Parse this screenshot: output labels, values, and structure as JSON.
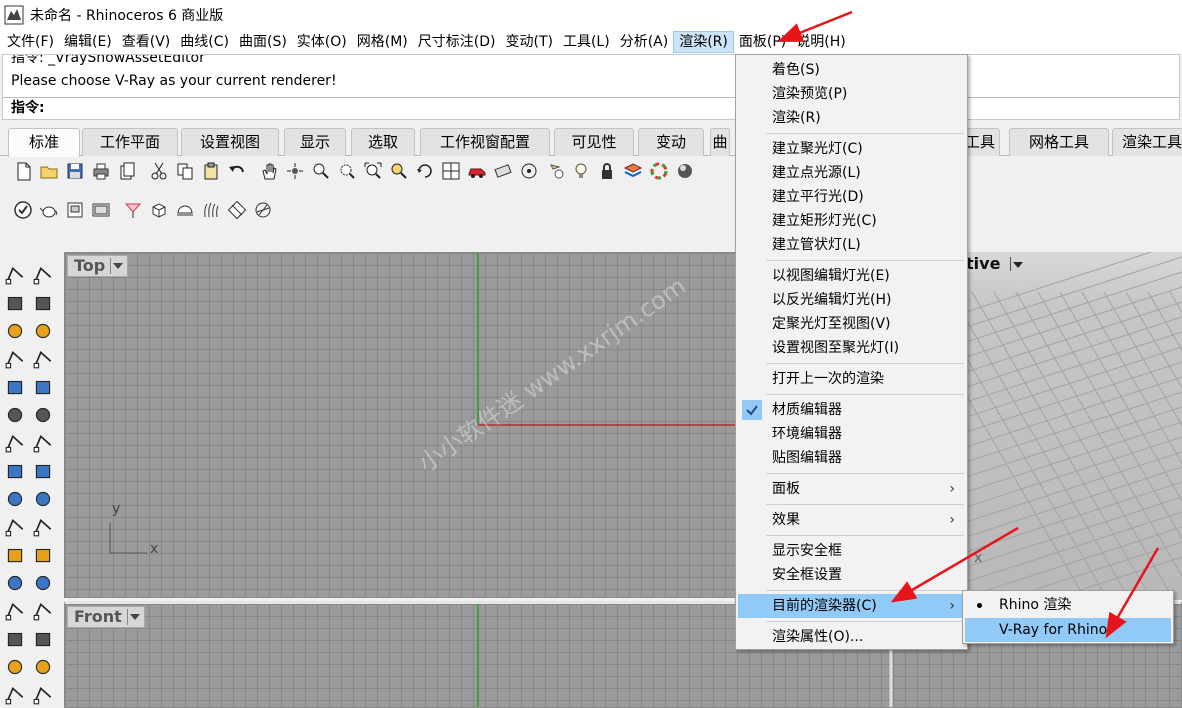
{
  "window": {
    "title": "未命名 - Rhinoceros 6 商业版"
  },
  "menubar": {
    "items": [
      "文件(F)",
      "编辑(E)",
      "查看(V)",
      "曲线(C)",
      "曲面(S)",
      "实体(O)",
      "网格(M)",
      "尺寸标注(D)",
      "变动(T)",
      "工具(L)",
      "分析(A)",
      "渲染(R)",
      "面板(P)",
      "说明(H)"
    ],
    "active_index": 11
  },
  "command": {
    "history_partial": "指令: _VrayShowAssetEditor",
    "message": "Please choose V-Ray as your current renderer!",
    "prompt": "指令:"
  },
  "tabs": {
    "items": [
      "标准",
      "工作平面",
      "设置视图",
      "显示",
      "选取",
      "工作视窗配置",
      "可见性",
      "变动",
      "曲",
      "工具",
      "网格工具",
      "渲染工具"
    ],
    "active_index": 0
  },
  "viewports": {
    "top": {
      "label": "Top",
      "axis_y": "y",
      "axis_x": "x"
    },
    "front": {
      "label": "Front"
    },
    "perspective": {
      "label": "tive",
      "axis_x": "x"
    }
  },
  "render_menu": {
    "items": [
      {
        "label": "着色(S)"
      },
      {
        "label": "渲染预览(P)"
      },
      {
        "label": "渲染(R)"
      },
      {
        "label": "建立聚光灯(C)"
      },
      {
        "label": "建立点光源(L)"
      },
      {
        "label": "建立平行光(D)"
      },
      {
        "label": "建立矩形灯光(C)"
      },
      {
        "label": "建立管状灯(L)"
      },
      {
        "label": "以视图编辑灯光(E)"
      },
      {
        "label": "以反光编辑灯光(H)"
      },
      {
        "label": "定聚光灯至视图(V)"
      },
      {
        "label": "设置视图至聚光灯(I)"
      },
      {
        "label": "打开上一次的渲染"
      },
      {
        "label": "材质编辑器",
        "checked": true
      },
      {
        "label": "环境编辑器"
      },
      {
        "label": "贴图编辑器"
      },
      {
        "label": "面板",
        "submenu": true
      },
      {
        "label": "效果",
        "submenu": true
      },
      {
        "label": "显示安全框"
      },
      {
        "label": "安全框设置"
      },
      {
        "label": "目前的渲染器(C)",
        "submenu": true,
        "highlighted": true
      },
      {
        "label": "渲染属性(O)..."
      }
    ]
  },
  "renderer_submenu": {
    "items": [
      {
        "label": "Rhino 渲染",
        "selected": true
      },
      {
        "label": "V-Ray for Rhino",
        "highlighted": true
      }
    ]
  },
  "watermark": "小小软件迷  www.xxrjm.com",
  "colors": {
    "menu_highlight": "#91c9f7",
    "active_menu": "#cce4f7",
    "arrow_red": "#e8141b",
    "x_axis": "#b0302a",
    "y_axis": "#2e9a2e",
    "viewport_bg": "#9b9b9b"
  },
  "icons": {
    "main_toolbar": [
      "new-file-icon",
      "open-folder-icon",
      "save-icon",
      "print-icon",
      "import-icon",
      "cut-icon",
      "copy-icon",
      "paste-icon",
      "undo-icon",
      "pan-hand-icon",
      "rotate-view-icon",
      "zoom-icon",
      "zoom-window-icon",
      "zoom-extents-icon",
      "zoom-selected-icon",
      "rotate-camera-icon",
      "four-viewports-icon",
      "car-icon",
      "options-icon",
      "target-icon",
      "light-bulb-select-icon",
      "light-bulb-icon",
      "lock-icon",
      "layer-icon",
      "color-wheel-icon",
      "render-sphere-icon"
    ],
    "secondary_toolbar": [
      "check-icon",
      "teapot-icon",
      "frame-buffer-icon",
      "frame-buffer-2-icon",
      "clipper-icon",
      "box-icon",
      "dome-light-icon",
      "fur-icon",
      "decal-icon",
      "infinite-plane-icon"
    ]
  }
}
